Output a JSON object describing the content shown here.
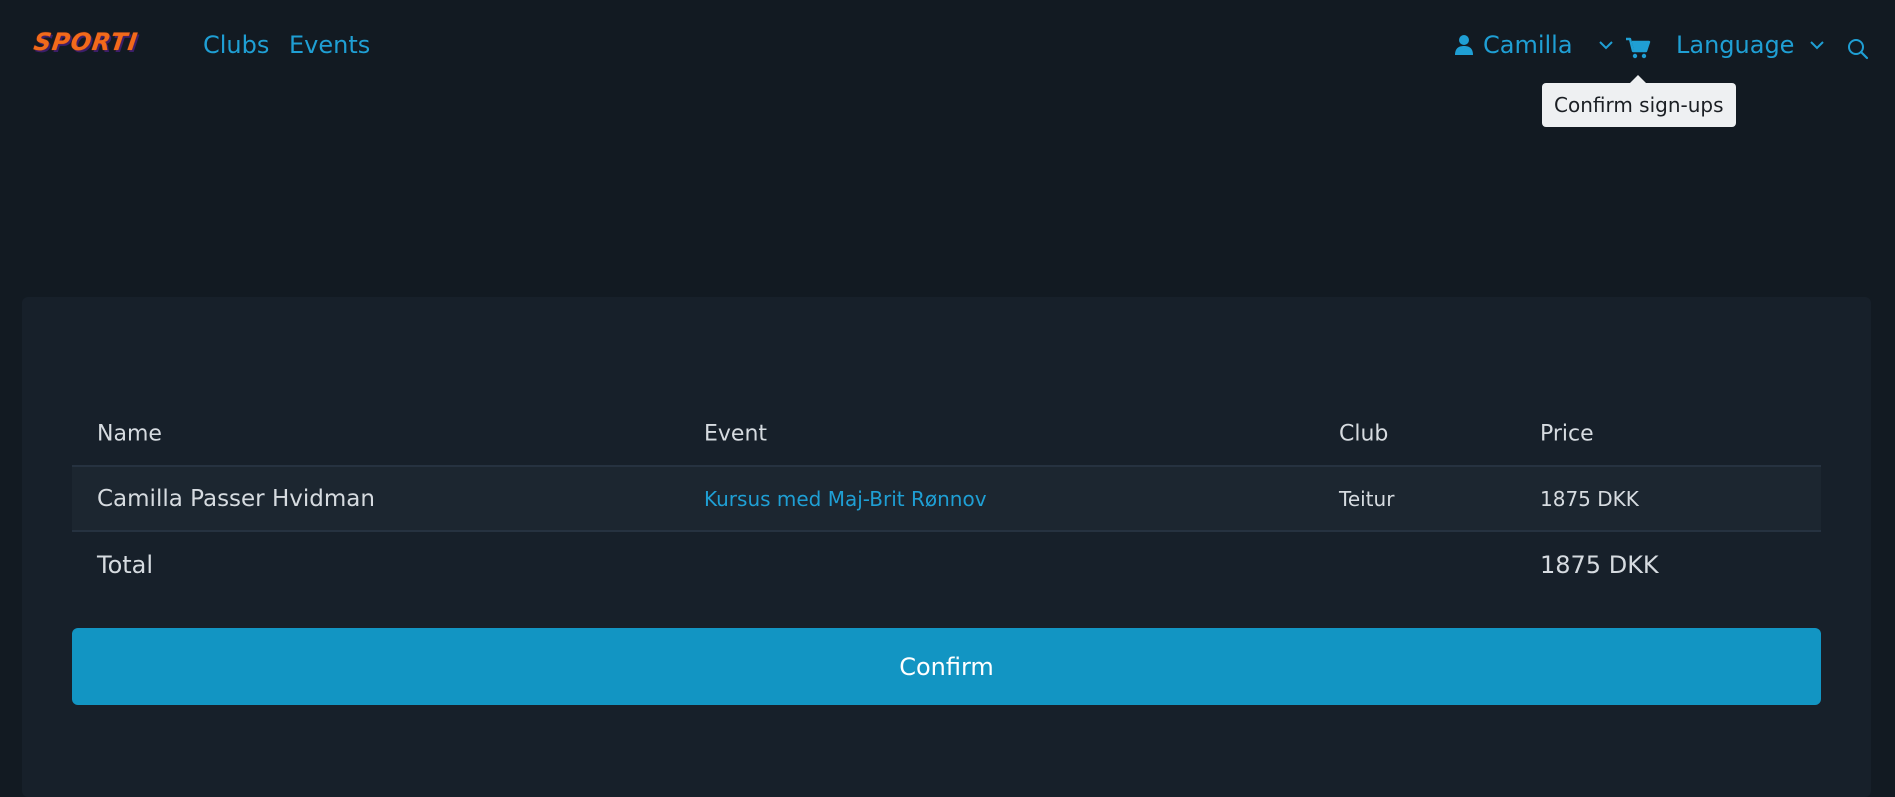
{
  "brand": {
    "logo_text": "SPORTI",
    "color": "#f26a1b"
  },
  "nav": {
    "links": [
      {
        "label": "Clubs"
      },
      {
        "label": "Events"
      }
    ],
    "user": {
      "label": "Camilla",
      "icon": "user-icon"
    },
    "cart": {
      "icon": "cart-icon",
      "tooltip": "Confirm sign-ups"
    },
    "language": {
      "label": "Language"
    },
    "search": {
      "icon": "search-icon"
    }
  },
  "table": {
    "headers": {
      "name": "Name",
      "event": "Event",
      "club": "Club",
      "price": "Price"
    },
    "rows": [
      {
        "name": "Camilla Passer Hvidman",
        "event": "Kursus med Maj-Brit Rønnov",
        "club": "Teitur",
        "price": "1875 DKK"
      }
    ],
    "total": {
      "label": "Total",
      "price": "1875 DKK"
    }
  },
  "confirm_button": {
    "label": "Confirm"
  },
  "colors": {
    "accent": "#1f9fd4",
    "button": "#1295c3",
    "background": "#121a22",
    "card": "#17202a"
  }
}
